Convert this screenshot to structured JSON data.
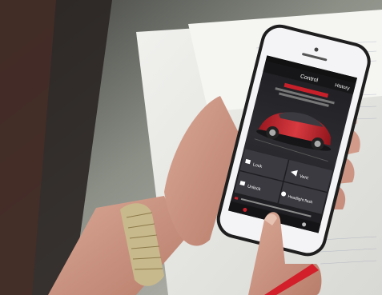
{
  "screen": {
    "status_bar": "",
    "header_title": "Control",
    "header_link": "History",
    "promo_headline": "",
    "promo_subline": "",
    "buttons": [
      "Lock",
      "Vent",
      "Unlock",
      "Headlight flash"
    ],
    "footer_message": ""
  },
  "colors": {
    "accent": "#c8202a",
    "screen_bg": "#2a2a2e",
    "card_bg": "#3a3a40"
  }
}
